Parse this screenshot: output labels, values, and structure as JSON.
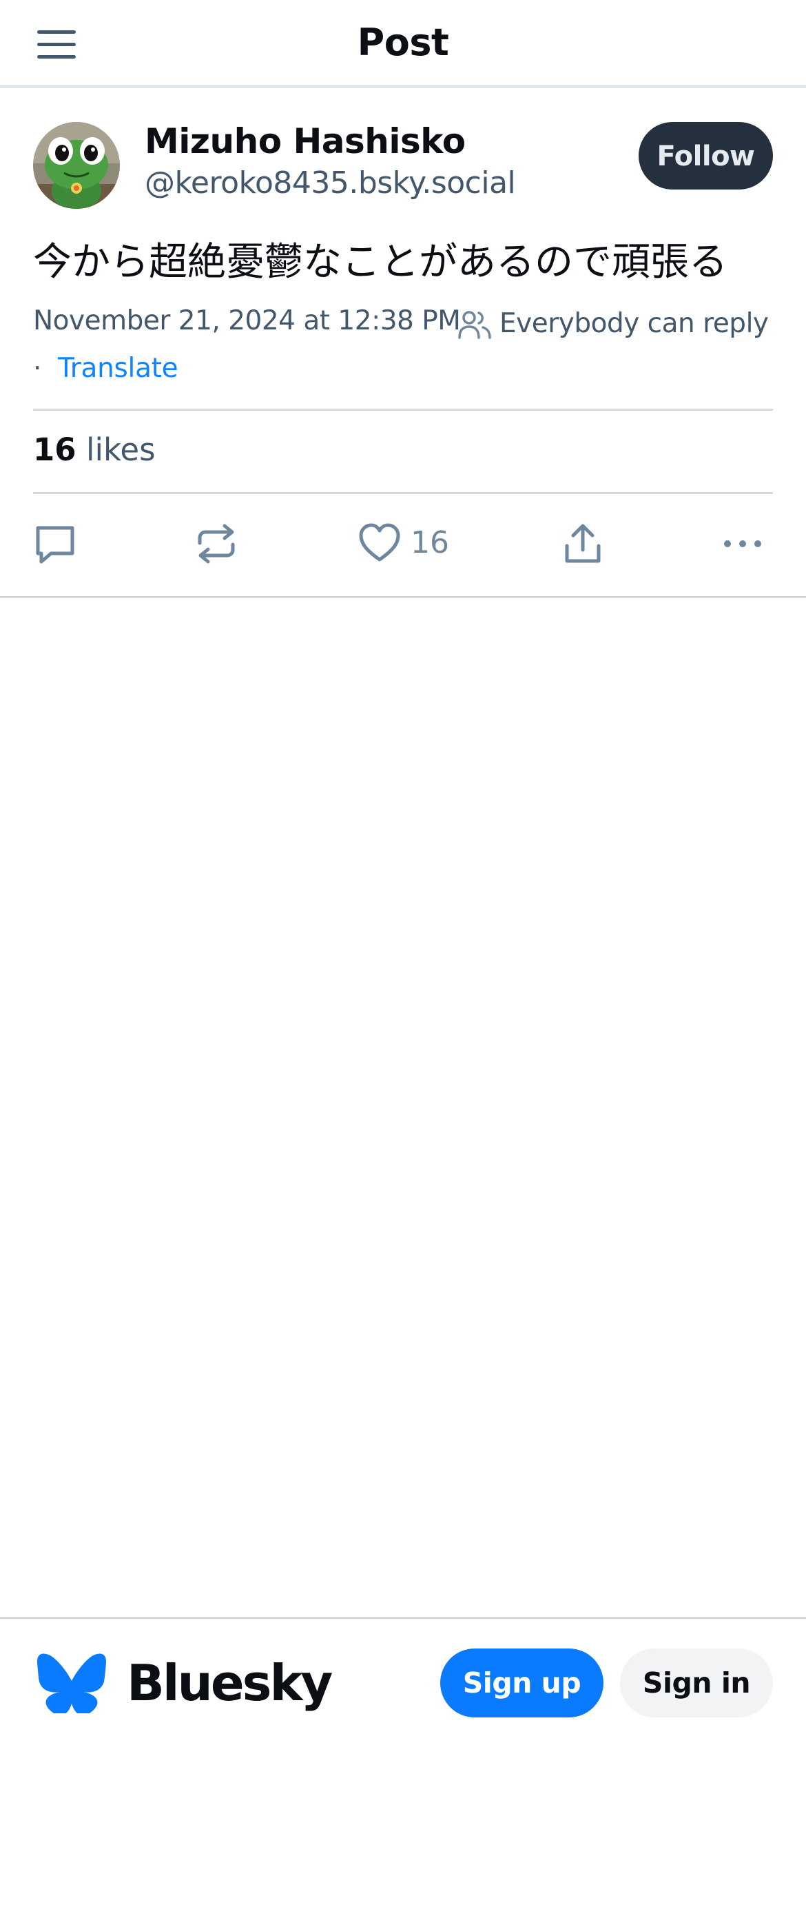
{
  "header": {
    "title": "Post",
    "menu_icon": "hamburger-menu-icon"
  },
  "post": {
    "author": {
      "display_name": "Mizuho Hashisko",
      "handle": "@keroko8435.bsky.social",
      "avatar": "green-frog-toy-avatar"
    },
    "follow_label": "Follow",
    "text": "今から超絶憂鬱なことがあるので頑張る",
    "timestamp": "November 21, 2024 at 12:38 PM",
    "reply_setting": "Everybody can reply",
    "reply_setting_icon": "people-icon",
    "separator": "·",
    "translate_label": "Translate",
    "likes": {
      "count": "16",
      "label": "likes"
    },
    "actions": {
      "reply_icon": "comment-icon",
      "repost_icon": "repost-icon",
      "like_icon": "heart-icon",
      "like_count": "16",
      "share_icon": "share-icon",
      "more_icon": "ellipsis-icon"
    }
  },
  "footer": {
    "brand": "Bluesky",
    "logo_icon": "butterfly-logo-icon",
    "signup_label": "Sign up",
    "signin_label": "Sign in"
  },
  "colors": {
    "text_primary": "#0b0f14",
    "text_secondary": "#42576c",
    "link": "#1083fe",
    "follow_bg": "#25303f",
    "brand_blue": "#0a7aff",
    "border": "#d4dbe2"
  }
}
